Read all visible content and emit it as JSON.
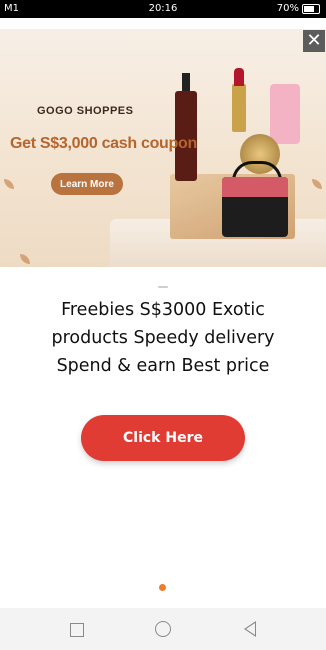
{
  "status_bar": {
    "carrier": "M1",
    "time": "20:16",
    "battery": "70%"
  },
  "ad": {
    "brand": "GOGO SHOPPES",
    "headline": "Get S$3,000 cash coupon",
    "learn_more": "Learn More",
    "close_symbol": "✕"
  },
  "message": {
    "line1": "Freebies S$3000 Exotic",
    "line2": "products Speedy delivery",
    "line3": "Spend & earn Best price"
  },
  "cta": {
    "label": "Click Here",
    "color": "#e13c34"
  },
  "colors": {
    "accent_dot": "#f07d2a",
    "close_bg": "#5c5c5c"
  },
  "navbar": {
    "icons": [
      "recent-apps-icon",
      "home-icon",
      "back-icon"
    ]
  }
}
